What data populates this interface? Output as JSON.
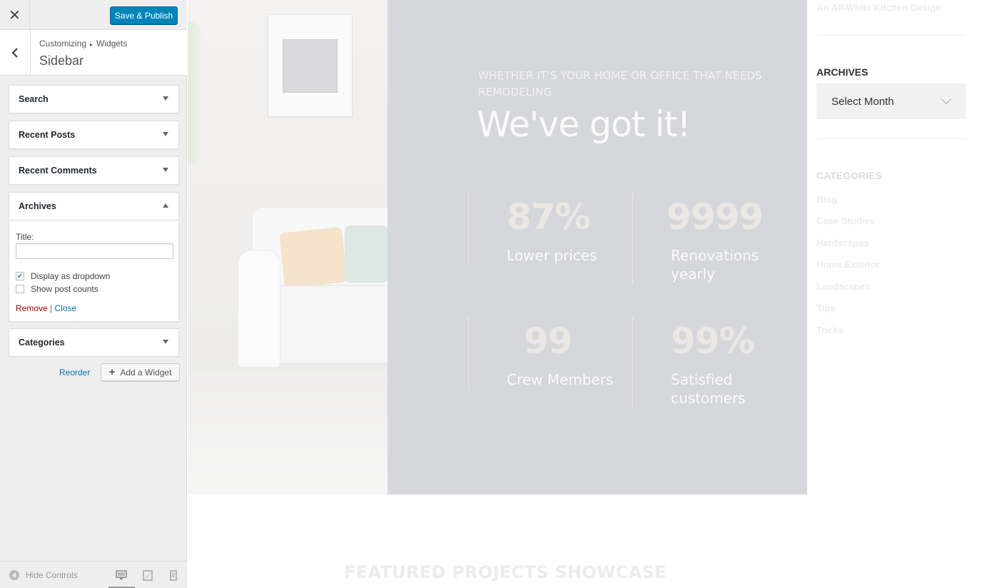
{
  "customizer": {
    "close_icon": "close-icon",
    "save_label": "Save & Publish",
    "breadcrumb": {
      "parent": "Customizing",
      "section": "Widgets"
    },
    "title": "Sidebar",
    "widgets": [
      {
        "label": "Search",
        "expanded": false
      },
      {
        "label": "Recent Posts",
        "expanded": false
      },
      {
        "label": "Recent Comments",
        "expanded": false
      },
      {
        "label": "Archives",
        "expanded": true
      },
      {
        "label": "Categories",
        "expanded": false
      }
    ],
    "archives_form": {
      "title_label": "Title:",
      "title_value": "",
      "dropdown_label": "Display as dropdown",
      "dropdown_checked": true,
      "counts_label": "Show post counts",
      "counts_checked": false,
      "remove_label": "Remove",
      "separator": "|",
      "close_label": "Close"
    },
    "reorder_label": "Reorder",
    "add_widget_label": "Add a Widget",
    "footer": {
      "hide_controls_label": "Hide Controls"
    },
    "colors": {
      "primary": "#0085ba",
      "remove": "#aa0000",
      "link": "#0073aa"
    }
  },
  "preview": {
    "hero": {
      "subheading": "WHETHER IT'S YOUR HOME OR OFFICE THAT NEEDS REMODELING",
      "heading": "We've got it!",
      "stats": [
        {
          "number": "87%",
          "label": "Lower prices"
        },
        {
          "number": "9999",
          "label": "Renovations yearly"
        },
        {
          "number": "99",
          "label": "Crew Members"
        },
        {
          "number": "99%",
          "label": "Satisfied customers"
        }
      ]
    },
    "sidebar": {
      "recent_post": "An All-White Kitchen Design",
      "archives_heading": "ARCHIVES",
      "archives_select": "Select Month",
      "categories_heading": "CATEGORIES",
      "categories": [
        "Blog",
        "Case Studies",
        "Hardscapes",
        "Home Exterior",
        "Landscapes",
        "Tips",
        "Tricks"
      ]
    },
    "featured_heading": "FEATURED PROJECTS SHOWCASE"
  }
}
